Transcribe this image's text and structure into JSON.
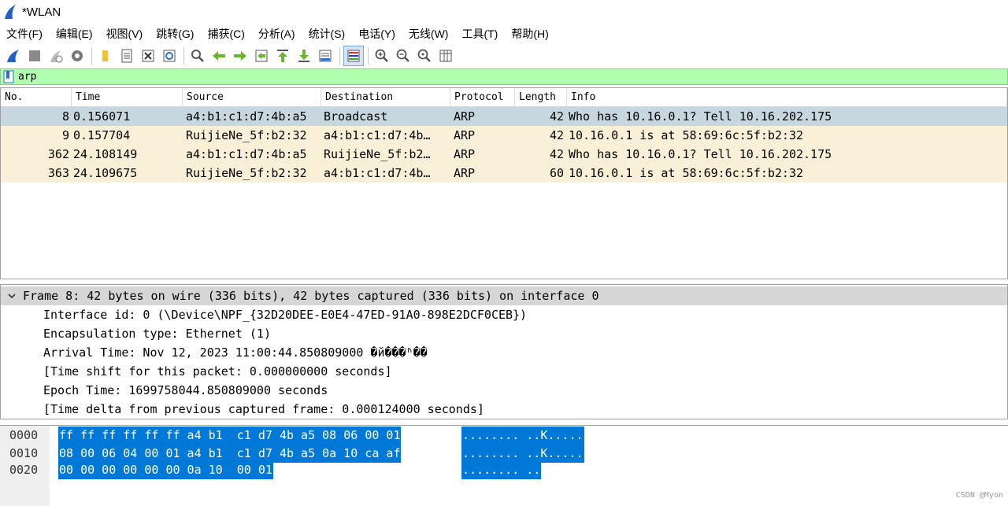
{
  "window": {
    "title": "*WLAN"
  },
  "menu": [
    "文件(F)",
    "编辑(E)",
    "视图(V)",
    "跳转(G)",
    "捕获(C)",
    "分析(A)",
    "统计(S)",
    "电话(Y)",
    "无线(W)",
    "工具(T)",
    "帮助(H)"
  ],
  "filter": {
    "value": "arp"
  },
  "packet_list": {
    "columns": [
      "No.",
      "Time",
      "Source",
      "Destination",
      "Protocol",
      "Length",
      "Info"
    ],
    "rows": [
      {
        "no": "8",
        "time": "0.156071",
        "source": "a4:b1:c1:d7:4b:a5",
        "destination": "Broadcast",
        "protocol": "ARP",
        "length": "42",
        "info": "Who has 10.16.0.1? Tell 10.16.202.175"
      },
      {
        "no": "9",
        "time": "0.157704",
        "source": "RuijieNe_5f:b2:32",
        "destination": "a4:b1:c1:d7:4b…",
        "protocol": "ARP",
        "length": "42",
        "info": "10.16.0.1 is at 58:69:6c:5f:b2:32"
      },
      {
        "no": "362",
        "time": "24.108149",
        "source": "a4:b1:c1:d7:4b:a5",
        "destination": "RuijieNe_5f:b2…",
        "protocol": "ARP",
        "length": "42",
        "info": "Who has 10.16.0.1? Tell 10.16.202.175"
      },
      {
        "no": "363",
        "time": "24.109675",
        "source": "RuijieNe_5f:b2:32",
        "destination": "a4:b1:c1:d7:4b…",
        "protocol": "ARP",
        "length": "60",
        "info": "10.16.0.1 is at 58:69:6c:5f:b2:32"
      }
    ]
  },
  "details": {
    "frame": "Frame 8: 42 bytes on wire (336 bits), 42 bytes captured (336 bits) on interface 0",
    "lines": [
      "Interface id: 0 (\\Device\\NPF_{32D20DEE-E0E4-47ED-91A0-898E2DCF0CEB})",
      "Encapsulation type: Ethernet (1)",
      "Arrival Time: Nov 12, 2023 11:00:44.850809000 �й���ʱ��",
      "[Time shift for this packet: 0.000000000 seconds]",
      "Epoch Time: 1699758044.850809000 seconds",
      "[Time delta from previous captured frame: 0.000124000 seconds]"
    ]
  },
  "bytes": [
    {
      "offset": "0000",
      "hex": "ff ff ff ff ff ff a4 b1  c1 d7 4b a5 08 06 00 01",
      "ascii": "........ ..K....."
    },
    {
      "offset": "0010",
      "hex": "08 00 06 04 00 01 a4 b1  c1 d7 4b a5 0a 10 ca af",
      "ascii": "........ ..K....."
    },
    {
      "offset": "0020",
      "hex": "00 00 00 00 00 00 0a 10  00 01",
      "ascii": "........ .."
    }
  ],
  "watermark": "CSDN @Myon⁠",
  "colors": {
    "filter_ok": "#afffaf",
    "row_selected": "#c7d7e0",
    "row_arp": "#faf0d7",
    "byte_highlight": "#0078d7"
  },
  "toolbar_icons": [
    "shark-fin-start-icon",
    "stop-icon",
    "restart-icon",
    "capture-options-icon",
    "open-file-icon",
    "save-file-icon",
    "close-file-icon",
    "reload-icon",
    "find-packet-icon",
    "go-back-icon",
    "go-forward-icon",
    "go-to-packet-icon",
    "go-first-icon",
    "go-last-icon",
    "autoscroll-icon",
    "colorize-icon",
    "zoom-in-icon",
    "zoom-out-icon",
    "zoom-normal-icon",
    "resize-columns-icon"
  ]
}
